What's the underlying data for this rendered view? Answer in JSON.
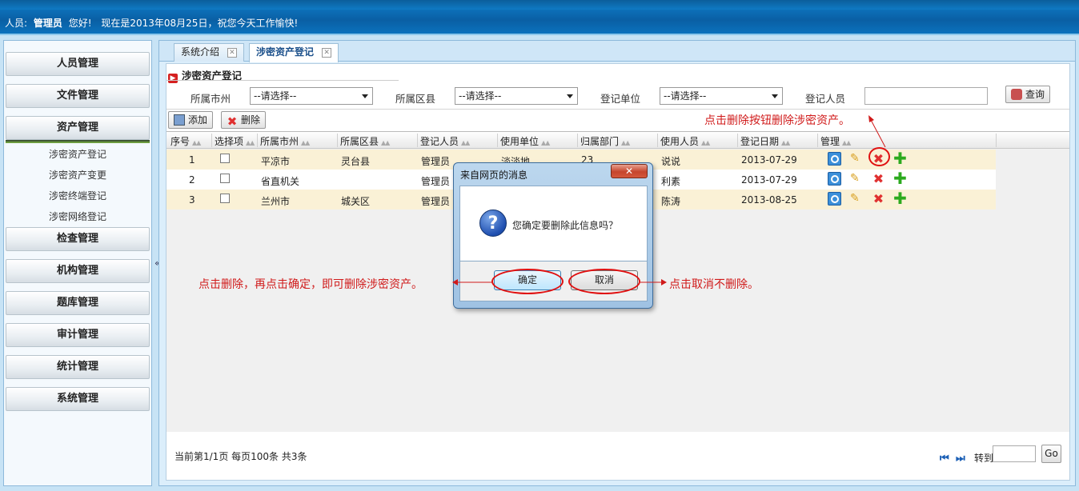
{
  "header": {
    "user_prefix": "人员:",
    "user_name": "管理员",
    "greeting": "您好!",
    "date_message": "现在是2013年08月25日，祝您今天工作愉快!"
  },
  "sidebar": {
    "menus": [
      {
        "label": "人员管理"
      },
      {
        "label": "文件管理"
      },
      {
        "label": "资产管理"
      },
      {
        "label": "检查管理"
      },
      {
        "label": "机构管理"
      },
      {
        "label": "题库管理"
      },
      {
        "label": "审计管理"
      },
      {
        "label": "统计管理"
      },
      {
        "label": "系统管理"
      }
    ],
    "sub_items": [
      "涉密资产登记",
      "涉密资产变更",
      "涉密终端登记",
      "涉密网络登记"
    ],
    "collapse_glyph": "«"
  },
  "tabs": [
    {
      "label": "系统介绍",
      "close": "✕"
    },
    {
      "label": "涉密资产登记",
      "close": "✕"
    }
  ],
  "panel": {
    "title": "涉密资产登记",
    "filters": {
      "city_label": "所属市州",
      "city_value": "--请选择--",
      "county_label": "所属区县",
      "county_value": "--请选择--",
      "unit_label": "登记单位",
      "unit_value": "--请选择--",
      "person_label": "登记人员",
      "person_value": ""
    },
    "search_button": "查询",
    "add_button": "添加",
    "delete_button": "删除"
  },
  "grid": {
    "columns": [
      "序号",
      "选择项",
      "所属市州",
      "所属区县",
      "登记人员",
      "使用单位",
      "归属部门",
      "使用人员",
      "登记日期",
      "管理"
    ],
    "sort_glyph": "▲▲",
    "rows": [
      {
        "no": "1",
        "city": "平凉市",
        "county": "灵台县",
        "registrar": "管理员",
        "unit": "淡淡地",
        "dept": "23",
        "user": "说说",
        "date": "2013-07-29"
      },
      {
        "no": "2",
        "city": "省直机关",
        "county": "",
        "registrar": "管理员",
        "unit": "",
        "dept": "",
        "user": "利素",
        "date": "2013-07-29"
      },
      {
        "no": "3",
        "city": "兰州市",
        "county": "城关区",
        "registrar": "管理员",
        "unit": "",
        "dept": "",
        "user": "陈涛",
        "date": "2013-08-25"
      }
    ],
    "action_icons": [
      "view-icon",
      "edit-icon",
      "delete-icon",
      "add-icon"
    ]
  },
  "pager": {
    "summary": "当前第1/1页  每页100条  共3条",
    "first_glyph": "⏮",
    "last_glyph": "⏭",
    "goto_label": "转到",
    "go_button": "Go"
  },
  "dialog": {
    "title": "来自网页的消息",
    "close": "✕",
    "icon": "?",
    "message": "您确定要删除此信息吗？",
    "ok": "确定",
    "cancel": "取消"
  },
  "annotations": {
    "delete_hint": "点击删除按钮删除涉密资产。",
    "confirm_hint": "点击删除，再点击确定，即可删除涉密资产。",
    "cancel_hint": "点击取消不删除。"
  },
  "colors": {
    "header_blue": "#0a5fa4",
    "annotation_red": "#d01a1a",
    "row_highlight": "#faf1d6"
  }
}
